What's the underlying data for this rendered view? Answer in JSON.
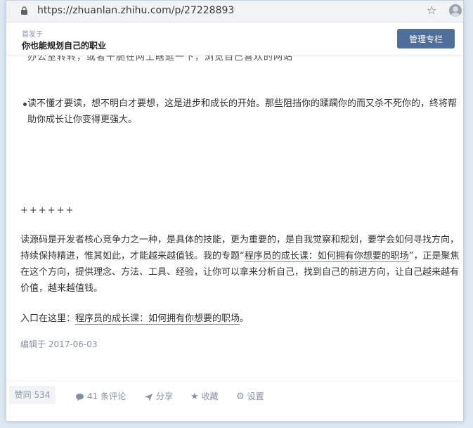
{
  "browser": {
    "url": "https://zhuanlan.zhihu.com/p/27228893"
  },
  "column": {
    "published_on_label": "首发于",
    "name": "你也能规划自己的职业",
    "manage_button": "管理专栏"
  },
  "article": {
    "cut_line": "办公室转转，或者干脆在网上瞎逛一下，浏览自己喜欢的网站",
    "bullet_text": "读不懂才要读，想不明白才要想，这是进步和成长的开始。那些阻挡你的蹂躏你的而又杀不死你的，终将帮助你成长让你变得更强大。",
    "separator": "++++++",
    "para_before_link": "读源码是开发者核心竞争力之一种，是具体的技能，更为重要的，是自我觉察和规划，要学会如何寻找方向，持续保持精进，惟其如此，才能越来越值钱。我的专题“",
    "para_link": "程序员的成长课：如何拥有你想要的职场",
    "para_after_link": "”，正是聚焦在这个方向，提供理念、方法、工具、经验，让你可以拿来分析自己，找到自己的前进方向，让自己越来越有价值，越来越值钱。",
    "entry_prefix": "入口在这里：",
    "entry_link": "程序员的成长课：如何拥有你想要的职场",
    "entry_suffix": "。",
    "edited": "编辑于 2017-06-03"
  },
  "actions": {
    "vote": "赞同 534",
    "comments": "41 条评论",
    "share": "分享",
    "favorite": "收藏",
    "settings": "设置"
  },
  "colors": {
    "accent": "#4f6f99",
    "meta": "#8590a6"
  }
}
